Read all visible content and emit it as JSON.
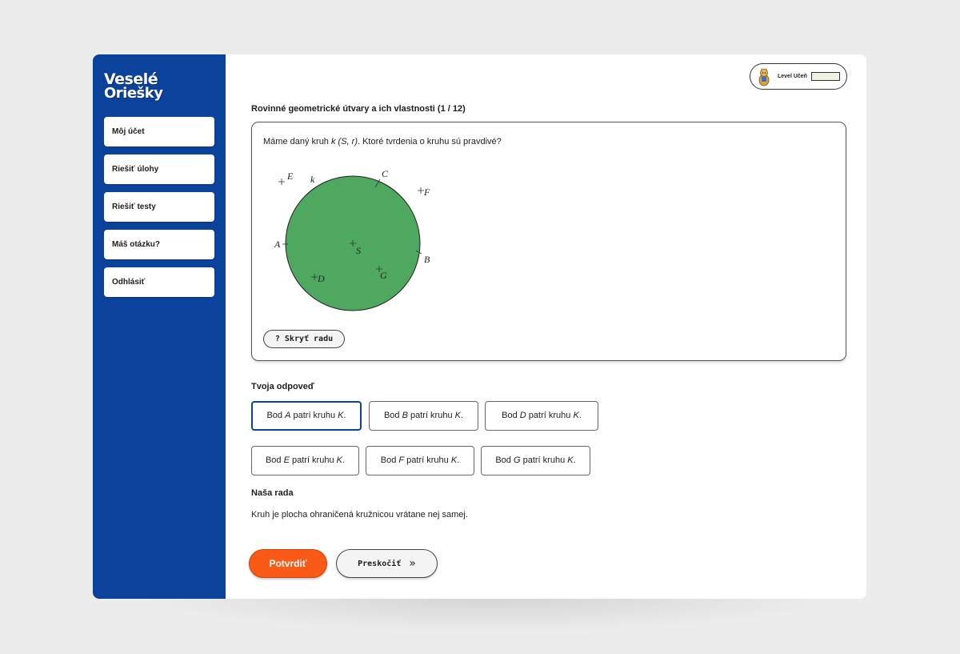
{
  "logo": {
    "line1": "Veselé",
    "line2": "Oriešky"
  },
  "sidebar": {
    "items": [
      {
        "label": "Môj účet"
      },
      {
        "label": "Riešiť úlohy"
      },
      {
        "label": "Riešiť testy"
      },
      {
        "label": "Máš otázku?"
      },
      {
        "label": "Odhlásiť"
      }
    ]
  },
  "level": {
    "label": "Level Učeň",
    "progress": 0,
    "bar_color": "#eef2e0",
    "avatar_icon": "squirrel-mascot-icon"
  },
  "section": {
    "title": "Rovinné geometrické útvary a ich vlastnosti (1 / 12)"
  },
  "question": {
    "text_before": "Máme daný kruh ",
    "text_math": "k (S, r)",
    "text_after": ". Ktoré tvrdenia o kruhu sú pravdivé?"
  },
  "figure": {
    "circle_label": "k",
    "fill_color": "#4fa860",
    "points": [
      {
        "label": "E"
      },
      {
        "label": "C"
      },
      {
        "label": "F"
      },
      {
        "label": "A"
      },
      {
        "label": "S"
      },
      {
        "label": "B"
      },
      {
        "label": "D"
      },
      {
        "label": "G"
      }
    ]
  },
  "hint_button": {
    "icon": "?",
    "label": "Skryť radu"
  },
  "answer": {
    "title": "Tvoja odpoveď",
    "options": [
      {
        "pre": "Bod ",
        "point": "A",
        "post": " patrí kruhu ",
        "set": "K",
        "end": ".",
        "selected": true
      },
      {
        "pre": "Bod ",
        "point": "B",
        "post": " patrí kruhu ",
        "set": "K",
        "end": ".",
        "selected": false
      },
      {
        "pre": "Bod ",
        "point": "D",
        "post": " patrí kruhu ",
        "set": "K",
        "end": ".",
        "selected": false
      },
      {
        "pre": "Bod ",
        "point": "E",
        "post": " patrí kruhu ",
        "set": "K",
        "end": ".",
        "selected": false
      },
      {
        "pre": "Bod ",
        "point": "F",
        "post": " patrí kruhu ",
        "set": "K",
        "end": ".",
        "selected": false
      },
      {
        "pre": "Bod ",
        "point": "G",
        "post": " patrí kruhu ",
        "set": "K",
        "end": ".",
        "selected": false
      }
    ]
  },
  "hint": {
    "title": "Naša rada",
    "text": "Kruh je plocha ohraničená kružnicou vrátane nej samej."
  },
  "actions": {
    "confirm_label": "Potvrdiť",
    "skip_label": "Preskočiť",
    "skip_icon": "double-chevron-right-icon"
  },
  "colors": {
    "sidebar": "#0b429b",
    "accent": "#fa5a16",
    "selected_border": "#0b429b"
  }
}
